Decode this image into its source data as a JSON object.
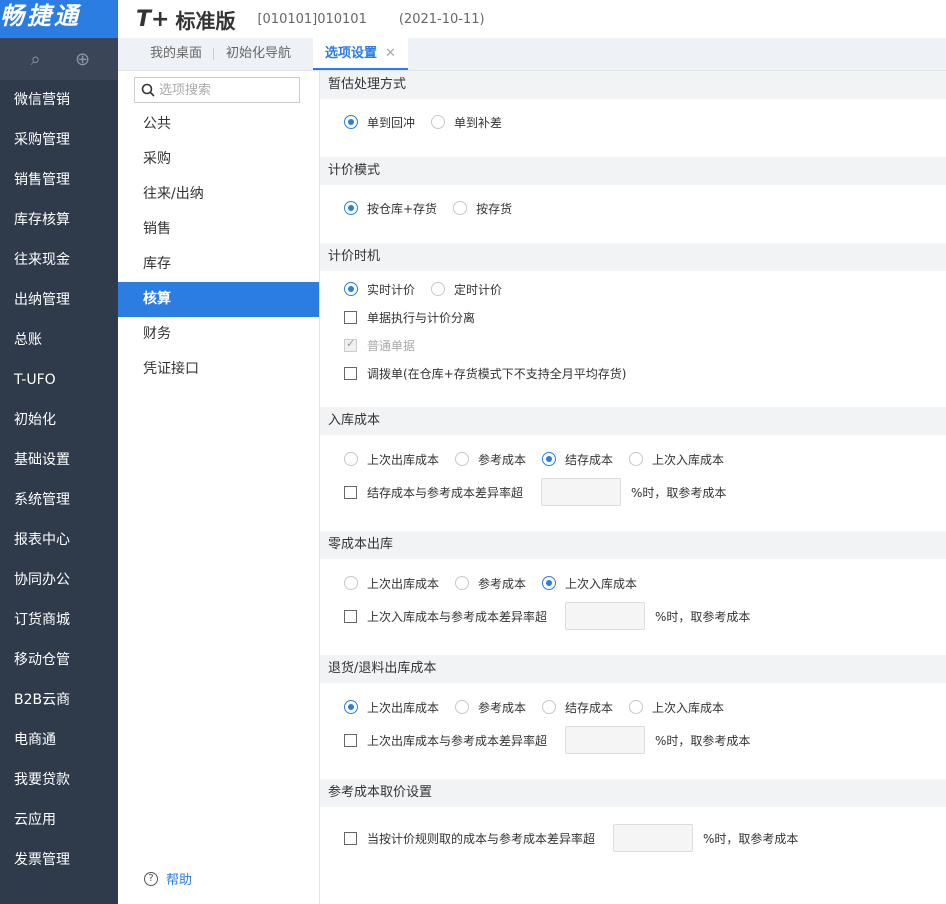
{
  "app": {
    "logo_text": "畅捷通",
    "brand": "T+",
    "brand_sub": "标准版",
    "account": "[010101]010101",
    "date": "(2021-10-11)"
  },
  "sidebar": {
    "items": [
      "微信营销",
      "采购管理",
      "销售管理",
      "库存核算",
      "往来现金",
      "出纳管理",
      "总账",
      "T-UFO",
      "初始化",
      "基础设置",
      "系统管理",
      "报表中心",
      "协同办公",
      "订货商城",
      "移动仓管",
      "B2B云商",
      "电商通",
      "我要贷款",
      "云应用",
      "发票管理"
    ]
  },
  "tabs": [
    {
      "label": "我的桌面"
    },
    {
      "label": "初始化导航"
    },
    {
      "label": "选项设置",
      "close": "✕"
    }
  ],
  "search": {
    "placeholder": "选项搜索"
  },
  "categories": [
    "公共",
    "采购",
    "往来/出纳",
    "销售",
    "库存",
    "核算",
    "财务",
    "凭证接口"
  ],
  "help_label": "帮助",
  "sections": {
    "s1": {
      "title": "暂估处理方式",
      "opts": [
        "单到回冲",
        "单到补差"
      ]
    },
    "s2": {
      "title": "计价模式",
      "opts": [
        "按仓库+存货",
        "按存货"
      ]
    },
    "s3": {
      "title": "计价时机",
      "opts": [
        "实时计价",
        "定时计价"
      ],
      "chk1": "单据执行与计价分离",
      "chk2": "普通单据",
      "chk3": "调拨单(在仓库+存货模式下不支持全月平均存货)"
    },
    "s4": {
      "title": "入库成本",
      "opts": [
        "上次出库成本",
        "参考成本",
        "结存成本",
        "上次入库成本"
      ],
      "chk": "结存成本与参考成本差异率超",
      "suffix": "%时，取参考成本"
    },
    "s5": {
      "title": "零成本出库",
      "opts": [
        "上次出库成本",
        "参考成本",
        "上次入库成本"
      ],
      "chk": "上次入库成本与参考成本差异率超",
      "suffix": "%时，取参考成本"
    },
    "s6": {
      "title": "退货/退料出库成本",
      "opts": [
        "上次出库成本",
        "参考成本",
        "结存成本",
        "上次入库成本"
      ],
      "chk": "上次出库成本与参考成本差异率超",
      "suffix": "%时，取参考成本"
    },
    "s7": {
      "title": "参考成本取价设置",
      "chk": "当按计价规则取的成本与参考成本差异率超",
      "suffix": "%时，取参考成本"
    }
  }
}
